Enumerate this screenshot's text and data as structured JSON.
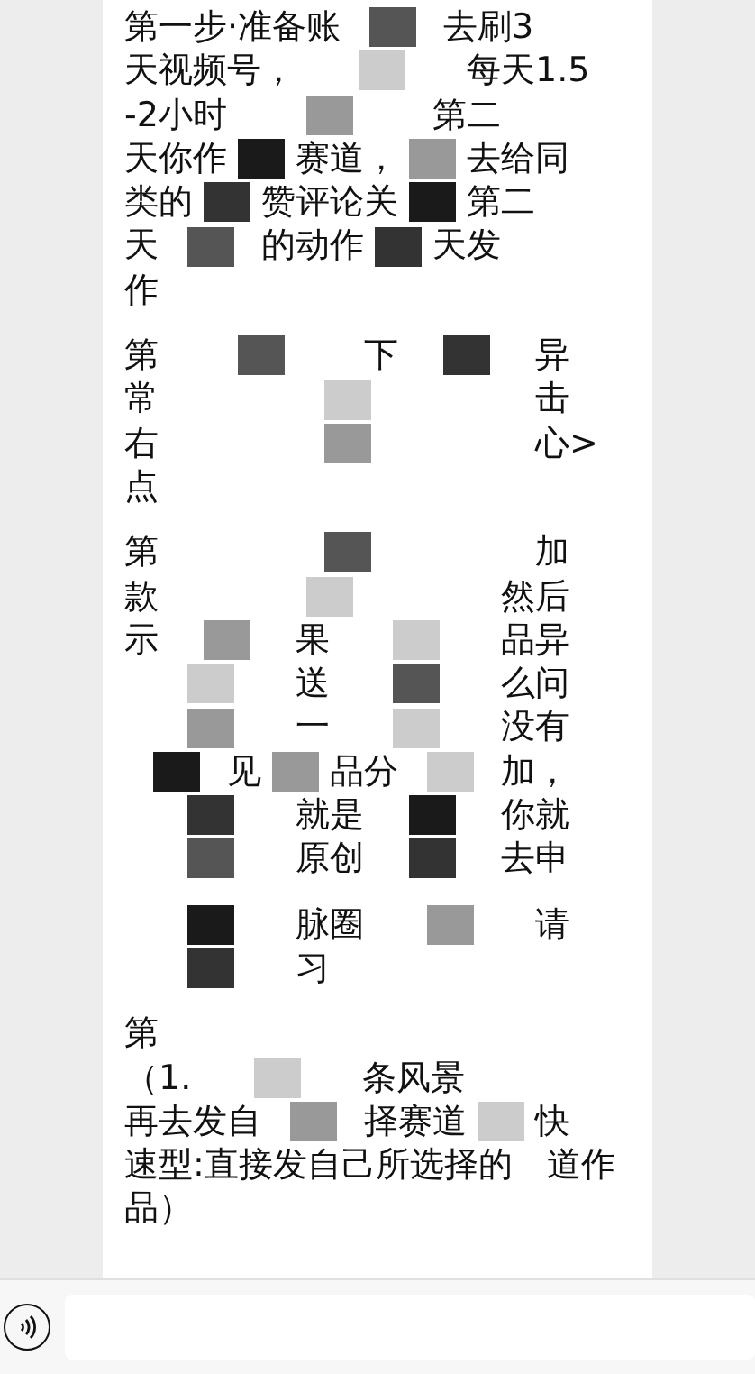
{
  "message": {
    "paragraphs": [
      {
        "lines": [
          "第一步·准备账　　　去刷3",
          "天视频号，　　　　　每天1.5",
          "-2小时　　　　　　第二",
          "天你作　　赛道，　　去给同",
          "类的　　赞评论关　　第二",
          "天　　　的动作　　天发",
          "作"
        ]
      },
      {
        "lines": [
          "第　　　　　　下　　　　异",
          "常　　　　　　　　　　　击",
          "右　　　　　　　　　　　心>",
          "点"
        ]
      },
      {
        "lines": [
          "第　　　　　　　　　　　加",
          "款　　　　　　　　　　然后",
          "示　　　　果　　　　　品异",
          "　　　　　送　　　　　么问",
          "　　　　　一　　　　　没有",
          "　　　见　　品分　　　加，",
          "　　　　　就是　　　　你就",
          "　　　　　原创　　　　去申"
        ]
      },
      {
        "lines": [
          "　　　　　脉圈　　　　　请",
          "　　　　　习"
        ]
      },
      {
        "lines": [
          "第",
          "（1.　　　　　条风景",
          "再去发自　　　择赛道　　快",
          "速型:直接发自己所选择的　道作",
          "品）"
        ]
      }
    ]
  },
  "input_bar": {
    "voice_button": true
  }
}
